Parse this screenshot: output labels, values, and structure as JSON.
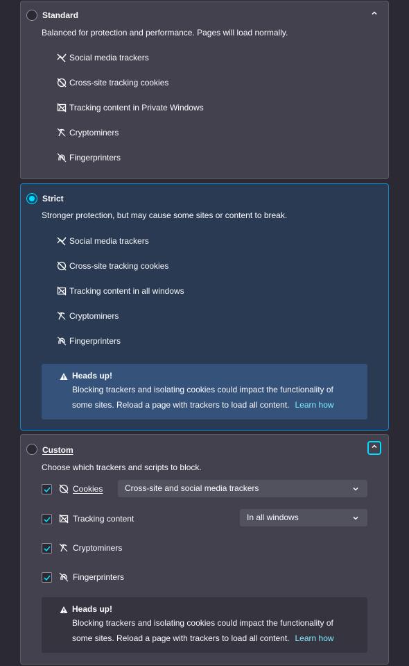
{
  "standard": {
    "title": "Standard",
    "description": "Balanced for protection and performance. Pages will load normally.",
    "features": [
      {
        "label": "Social media trackers",
        "icon": "social-tracker-icon"
      },
      {
        "label": "Cross-site tracking cookies",
        "icon": "cookie-icon"
      },
      {
        "label": "Tracking content in Private Windows",
        "icon": "tracking-content-icon"
      },
      {
        "label": "Cryptominers",
        "icon": "cryptominer-icon"
      },
      {
        "label": "Fingerprinters",
        "icon": "fingerprinter-icon"
      }
    ],
    "selected": false
  },
  "strict": {
    "title": "Strict",
    "description": "Stronger protection, but may cause some sites or content to break.",
    "features": [
      {
        "label": "Social media trackers",
        "icon": "social-tracker-icon"
      },
      {
        "label": "Cross-site tracking cookies",
        "icon": "cookie-icon"
      },
      {
        "label": "Tracking content in all windows",
        "icon": "tracking-content-icon"
      },
      {
        "label": "Cryptominers",
        "icon": "cryptominer-icon"
      },
      {
        "label": "Fingerprinters",
        "icon": "fingerprinter-icon"
      }
    ],
    "selected": true,
    "warning": {
      "title": "Heads up!",
      "body_line1": "Blocking trackers and isolating cookies could impact the functionality of",
      "body_line2": "some sites. Reload a page with trackers to load all content.",
      "link": "Learn how"
    }
  },
  "custom": {
    "title": "Custom",
    "description": "Choose which trackers and scripts to block.",
    "selected": false,
    "options": {
      "cookies": {
        "label": "Cookies",
        "checked": true,
        "select_value": "Cross-site and social media trackers"
      },
      "tracking": {
        "label": "Tracking content",
        "checked": true,
        "select_value": "In all windows"
      },
      "cryptominers": {
        "label": "Cryptominers",
        "checked": true
      },
      "fingerprinters": {
        "label": "Fingerprinters",
        "checked": true
      }
    },
    "warning": {
      "title": "Heads up!",
      "body_line1": "Blocking trackers and isolating cookies could impact the functionality of",
      "body_line2": "some sites. Reload a page with trackers to load all content.",
      "link": "Learn how"
    }
  },
  "colors": {
    "page_bg": "#2b2a33",
    "card_bg": "#42414d",
    "selected_card_bg": "#293a52",
    "accent": "#00ddff",
    "link": "#80ebff"
  }
}
